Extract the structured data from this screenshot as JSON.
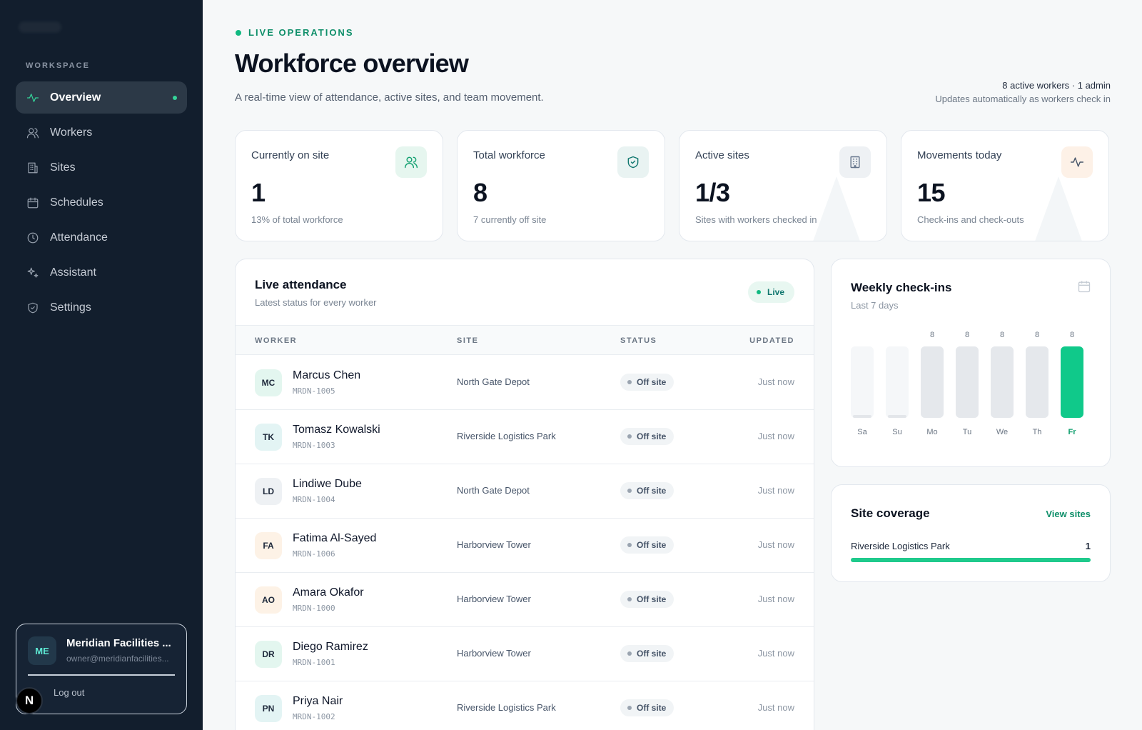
{
  "sidebar": {
    "section_label": "WORKSPACE",
    "items": [
      {
        "label": "Overview",
        "icon": "activity-icon",
        "active": true
      },
      {
        "label": "Workers",
        "icon": "users-icon"
      },
      {
        "label": "Sites",
        "icon": "building-icon"
      },
      {
        "label": "Schedules",
        "icon": "calendar-icon"
      },
      {
        "label": "Attendance",
        "icon": "clock-icon"
      },
      {
        "label": "Assistant",
        "icon": "sparkles-icon"
      },
      {
        "label": "Settings",
        "icon": "shield-icon"
      }
    ],
    "user": {
      "initials": "ME",
      "name": "Meridian Facilities ...",
      "email": "owner@meridianfacilities...",
      "logout_label": "Log out"
    },
    "badge": "N"
  },
  "header": {
    "eyebrow": "LIVE OPERATIONS",
    "title": "Workforce overview",
    "subtitle": "A real-time view of attendance, active sites, and team movement.",
    "meta_line1": "8 active workers · 1 admin",
    "meta_line2": "Updates automatically as workers check in"
  },
  "stats": [
    {
      "label": "Currently on site",
      "value": "1",
      "hint": "13% of total workforce",
      "icon": "users-icon",
      "accent": "#0f9f6e",
      "icon_bg": "#e6f6ef"
    },
    {
      "label": "Total workforce",
      "value": "8",
      "hint": "7 currently off site",
      "icon": "shield-check-icon",
      "accent": "#0f766e",
      "icon_bg": "#e9f3f2"
    },
    {
      "label": "Active sites",
      "value": "1/3",
      "hint": "Sites with workers checked in",
      "icon": "building-icon",
      "accent": "#64748b",
      "icon_bg": "#eef1f4"
    },
    {
      "label": "Movements today",
      "value": "15",
      "hint": "Check-ins and check-outs",
      "icon": "activity-icon",
      "accent": "#c2410c",
      "icon_bg": "#fdf1e7"
    }
  ],
  "attendance": {
    "title": "Live attendance",
    "subtitle": "Latest status for every worker",
    "live_label": "Live",
    "columns": [
      "WORKER",
      "SITE",
      "STATUS",
      "UPDATED"
    ],
    "rows": [
      {
        "initials": "MC",
        "name": "Marcus Chen",
        "id": "MRDN-1005",
        "site": "North Gate Depot",
        "status": "Off site",
        "updated": "Just now",
        "avatar_bg": "#e3f6ef"
      },
      {
        "initials": "TK",
        "name": "Tomasz Kowalski",
        "id": "MRDN-1003",
        "site": "Riverside Logistics Park",
        "status": "Off site",
        "updated": "Just now",
        "avatar_bg": "#e3f4f4"
      },
      {
        "initials": "LD",
        "name": "Lindiwe Dube",
        "id": "MRDN-1004",
        "site": "North Gate Depot",
        "status": "Off site",
        "updated": "Just now",
        "avatar_bg": "#eef1f4"
      },
      {
        "initials": "FA",
        "name": "Fatima Al-Sayed",
        "id": "MRDN-1006",
        "site": "Harborview Tower",
        "status": "Off site",
        "updated": "Just now",
        "avatar_bg": "#fdf2e6"
      },
      {
        "initials": "AO",
        "name": "Amara Okafor",
        "id": "MRDN-1000",
        "site": "Harborview Tower",
        "status": "Off site",
        "updated": "Just now",
        "avatar_bg": "#fdf2e6"
      },
      {
        "initials": "DR",
        "name": "Diego Ramirez",
        "id": "MRDN-1001",
        "site": "Harborview Tower",
        "status": "Off site",
        "updated": "Just now",
        "avatar_bg": "#e3f6ef"
      },
      {
        "initials": "PN",
        "name": "Priya Nair",
        "id": "MRDN-1002",
        "site": "Riverside Logistics Park",
        "status": "Off site",
        "updated": "Just now",
        "avatar_bg": "#e3f4f4"
      }
    ]
  },
  "weekly": {
    "title": "Weekly check-ins",
    "subtitle": "Last 7 days",
    "icon": "calendar-icon"
  },
  "chart_data": {
    "type": "bar",
    "categories": [
      "Sa",
      "Su",
      "Mo",
      "Tu",
      "We",
      "Th",
      "Fr"
    ],
    "values": [
      0,
      0,
      8,
      8,
      8,
      8,
      8
    ],
    "value_labels": [
      "",
      "",
      "8",
      "8",
      "8",
      "8",
      "8"
    ],
    "highlight_index": 6,
    "ylim": [
      0,
      8
    ],
    "highlight_color": "#10c98a",
    "bar_color": "#e5e8ec"
  },
  "coverage": {
    "title": "Site coverage",
    "link_label": "View sites",
    "sites": [
      {
        "name": "Riverside Logistics Park",
        "count": "1",
        "fraction": 1.0
      }
    ]
  }
}
